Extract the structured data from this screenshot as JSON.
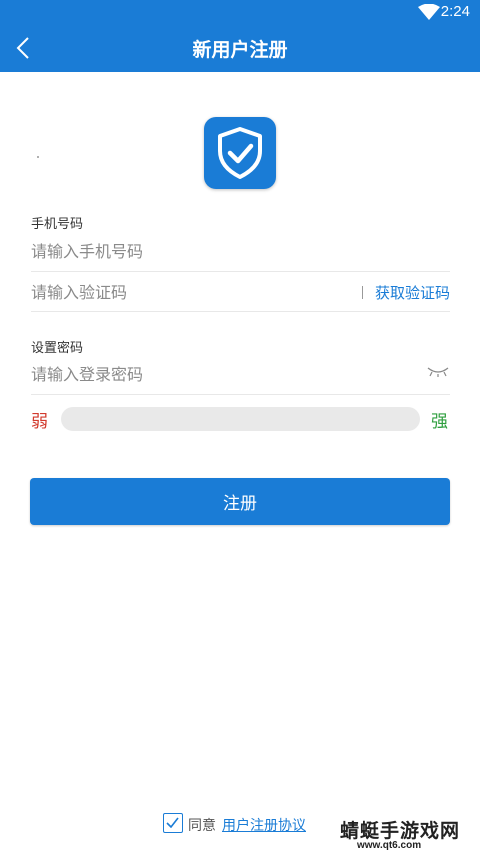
{
  "status_bar": {
    "time": "2:24",
    "wifi_icon": "wifi-icon"
  },
  "header": {
    "title": "新用户注册",
    "back_icon": "back-arrow-icon"
  },
  "logo": {
    "icon": "shield-check-icon",
    "color": "#1a7cd6"
  },
  "form": {
    "phone_label": "手机号码",
    "phone_placeholder": "请输入手机号码",
    "phone_value": "",
    "code_placeholder": "请输入验证码",
    "code_value": "",
    "get_code_label": "获取验证码",
    "password_label": "设置密码",
    "password_placeholder": "请输入登录密码",
    "password_value": "",
    "eye_icon": "eye-closed-icon",
    "strength_weak": "弱",
    "strength_strong": "强",
    "strength_level": 0
  },
  "register_button": "注册",
  "agreement": {
    "checked": true,
    "prefix": "同意",
    "link": "用户注册协议"
  },
  "watermark": {
    "text": "蜻蜓手游戏网",
    "url": "www.qt6.com"
  },
  "colors": {
    "primary": "#1a7cd6",
    "weak": "#d23a2d",
    "strong": "#2e9e3e"
  }
}
